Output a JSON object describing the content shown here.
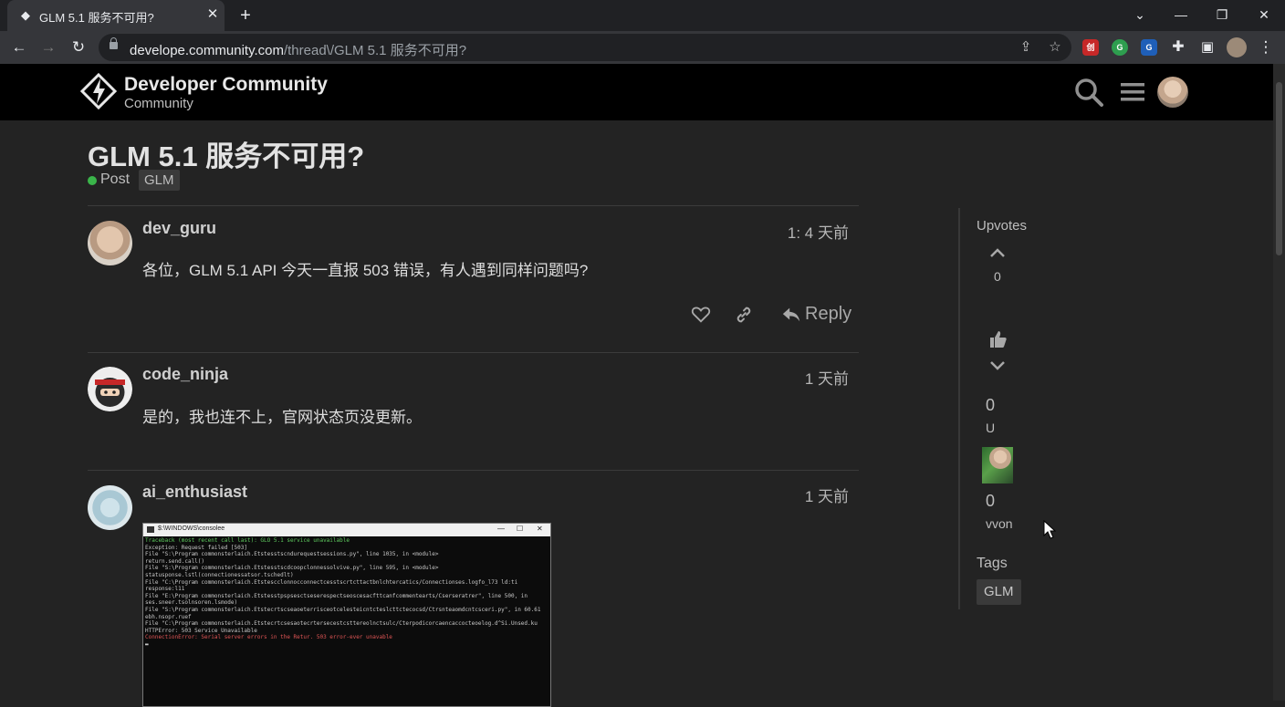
{
  "browser": {
    "tab_title": "GLM 5.1 服务不可用?",
    "url_host": "develope.community.com",
    "url_path": "/thread\\/GLM 5.1 服务不可用?"
  },
  "site": {
    "name": "Developer Community",
    "subtitle": "Community"
  },
  "topic": {
    "title": "GLM 5.1 服务不可用?",
    "category": "Post",
    "tag": "GLM"
  },
  "posts": [
    {
      "author": "dev_guru",
      "date": "1: 4 天前",
      "body": "各位，GLM 5.1 API 今天一直报 503 错误，有人遇到同样问题吗?",
      "reply_label": "Reply"
    },
    {
      "author": "code_ninja",
      "date": "1 天前",
      "body": "是的，我也连不上，官网状态页没更新。"
    },
    {
      "author": "ai_enthusiast",
      "date": "1 天前"
    }
  ],
  "terminal": {
    "title": "$:\\WINDOWS\\consolee",
    "lines": [
      "Traceback (most recent call last): GLO 5.1 service unavailable",
      "Exception: Request failed [503]",
      "  File \"S:\\Program commonsterlaich.Etstesstscndurequestsessions.py\", line 1035, in <module>",
      "    return.send.call()",
      "  File \"S:\\Program commonsterlaich.Etstesstscdcoopclonnessolvive.py\", line 595, in <module>",
      "    statusponse.lstl(connectionessatsor.tschedlt)",
      "  File \"C:\\Program commonsterlaich.Etstescclonnocconnectcesstscrtcttactbnlchtercatics/Connectionses.logfo_l73 ld:ti",
      "  response:l11",
      "  File \"E:\\Program commonsterlaich.Etstesstpspsesctseserespectseoscesacfttcanfcommentearts/Cserseratrer\", line 500, in",
      "  ses.sneer.tsolnsoren.lsmode)",
      "  File \"S:\\Program commonsterlaich.Etstecrtscseaoeterrisceotcelesteicntcteslcttctecocsd/Ctrsnteaomdcntcsceri.py\", in 60.61",
      "  ebh.nsopr.ruef",
      "  File \"C:\\Program commonsterlaich.Etstecrtcsesaotecrtersecestcsttereolnctsulc/Cterpodicorcaencaccocteoelog.d^Si.Unsed.ku",
      "  HTTPError: 503 Service Unavailable",
      "ConnectionError: Serial server errors in the Retur. 503 error-ever unavable"
    ],
    "prompt": "▬"
  },
  "sidebar": {
    "upvotes_label": "Upvotes",
    "vote_count": "0",
    "count_a": "0",
    "label_a": "U",
    "count_b": "0",
    "label_b": "vvon",
    "tags_label": "Tags",
    "tag": "GLM"
  },
  "colors": {
    "header_bg": "#000000",
    "page_bg": "#232323",
    "category_dot": "#3ab54a",
    "chip_bg": "#3a3a3a"
  },
  "icons": [
    "diamond-favicon",
    "close-icon",
    "plus-icon",
    "back-icon",
    "forward-icon",
    "reload-icon",
    "lock-icon",
    "share-icon",
    "star-icon",
    "puzzle-icon",
    "sidepanel-icon",
    "kebab-menu-icon",
    "logo-icon",
    "search-icon",
    "hamburger-icon",
    "heart-icon",
    "link-icon",
    "reply-icon",
    "chevron-up-icon",
    "chevron-down-icon",
    "thumbs-up-icon"
  ]
}
